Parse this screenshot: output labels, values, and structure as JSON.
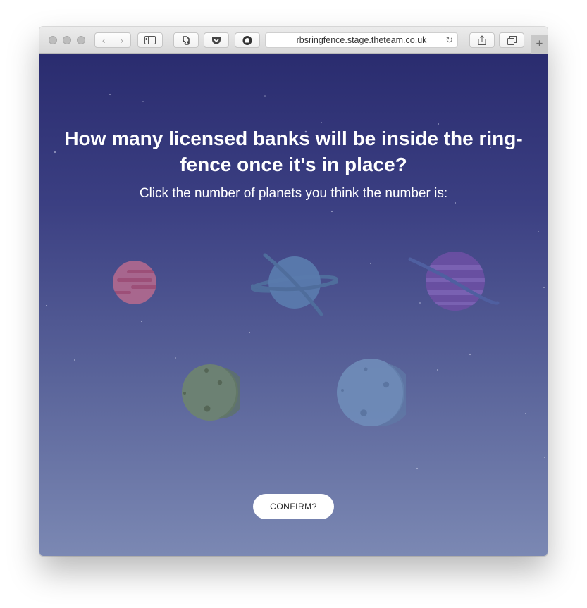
{
  "browser": {
    "url": "rbsringfence.stage.theteam.co.uk",
    "back_glyph": "‹",
    "forward_glyph": "›",
    "reload_glyph": "↻",
    "new_tab_glyph": "+"
  },
  "quiz": {
    "question": "How many licensed banks will be inside the ring-fence once it's in place?",
    "instruction": "Click the number of planets you think the number is:",
    "confirm_label": "CONFIRM?",
    "planets": [
      {
        "name": "pink-striped-planet",
        "color": "#b86b8e"
      },
      {
        "name": "blue-ringed-planet",
        "color": "#5a7cae"
      },
      {
        "name": "purple-ringed-planet",
        "color": "#6b4fa3"
      },
      {
        "name": "green-cratered-planet",
        "color": "#6e8370"
      },
      {
        "name": "blue-cratered-planet",
        "color": "#6f8cb9"
      }
    ]
  },
  "colors": {
    "background_top": "#2a2c6f",
    "background_bottom": "#7b88b3",
    "button_bg": "#ffffff"
  }
}
